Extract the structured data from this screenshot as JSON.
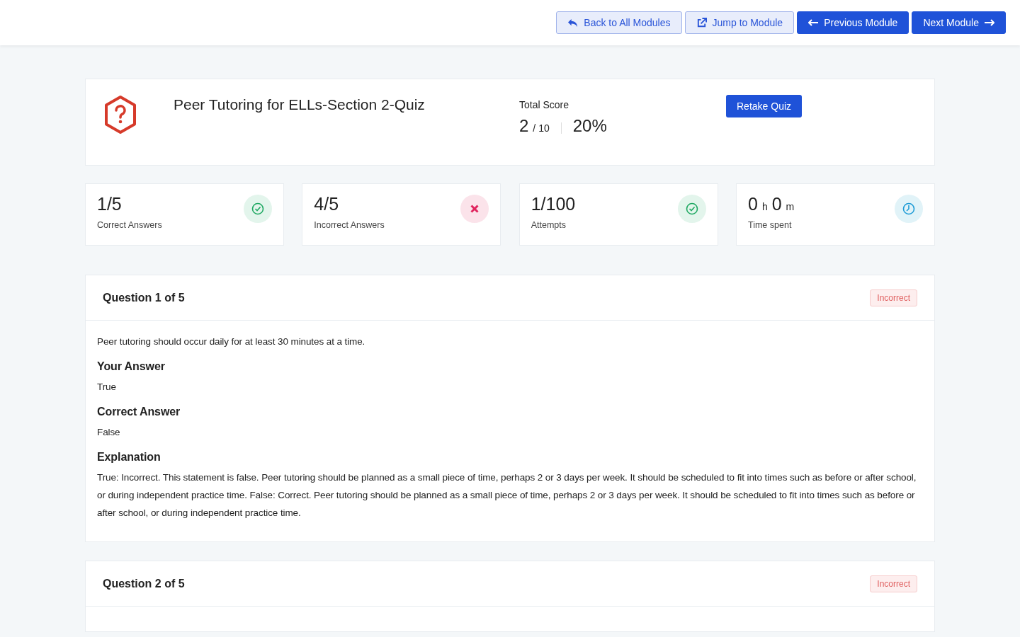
{
  "header": {
    "buttons": [
      {
        "label": "Back to All Modules",
        "kind": "back",
        "primary": false
      },
      {
        "label": "Jump to Module",
        "kind": "jump",
        "primary": false
      },
      {
        "label": "Previous Module",
        "kind": "previous",
        "primary": true
      },
      {
        "label": "Next Module",
        "kind": "next",
        "primary": true
      }
    ]
  },
  "summary": {
    "title": "Peer Tutoring for ELLs-Section 2-Quiz",
    "score_label": "Total Score",
    "score": "2",
    "total": "/ 10",
    "percent": "20%",
    "action": "Retake Quiz"
  },
  "stats": [
    {
      "value": "1/5",
      "label": "Correct Answers",
      "kind": "correct"
    },
    {
      "value": "4/5",
      "label": "Incorrect Answers",
      "kind": "incorrect"
    },
    {
      "value": "1/100",
      "label": "Attempts",
      "kind": "correct"
    },
    {
      "value": "0",
      "unit": "h",
      "value2": "0",
      "unit2": "m",
      "label": "Time spent",
      "kind": "time"
    }
  ],
  "questions": [
    {
      "title": "Question 1 of 5",
      "status": "Incorrect",
      "text": "Peer tutoring should occur daily for at least 30 minutes at a time.",
      "sections": [
        {
          "heading": "Your Answer",
          "text": "True"
        },
        {
          "heading": "Correct Answer",
          "text": "False"
        },
        {
          "heading": "Explanation",
          "text": "True: Incorrect. This statement is false. Peer tutoring should be planned as a small piece of time, perhaps 2 or 3 days per week. It should be scheduled to fit into times such as before or after school, or during independent practice time. False: Correct. Peer tutoring should be planned as a small piece of time, perhaps 2 or 3 days per week. It should be scheduled to fit into times such as before or after school, or during independent practice time."
        }
      ]
    },
    {
      "title": "Question 2 of 5",
      "status": "Incorrect"
    }
  ]
}
